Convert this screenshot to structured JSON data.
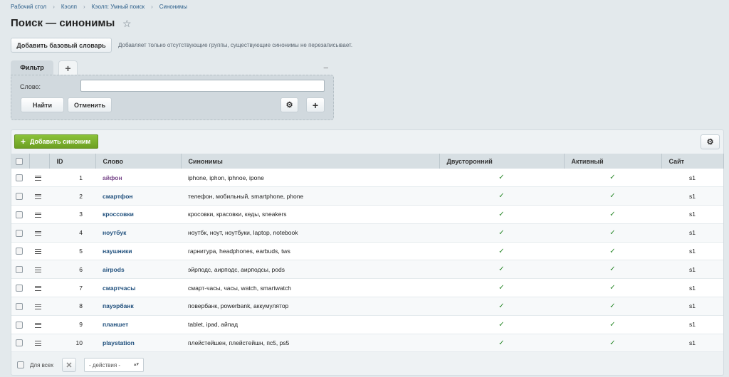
{
  "breadcrumb": [
    "Рабочий стол",
    "Кэолп",
    "Кэолп: Умный поиск",
    "Синонимы"
  ],
  "title": "Поиск — синонимы",
  "toolbar": {
    "base_dict_label": "Добавить базовый словарь",
    "base_dict_hint": "Добавляет только отсутствующие группы, существующие синонимы не перезаписывает."
  },
  "filter": {
    "tab_label": "Фильтр",
    "add_tab": "+",
    "collapse": "−",
    "word_label": "Слово:",
    "word_value": "",
    "find_label": "Найти",
    "cancel_label": "Отменить",
    "gear": "⚙",
    "plus": "+"
  },
  "grid": {
    "add_label": "Добавить синоним",
    "add_icon": "+",
    "gear": "⚙",
    "columns": [
      "ID",
      "Слово",
      "Синонимы",
      "Двусторонний",
      "Активный",
      "Сайт"
    ],
    "rows": [
      {
        "id": "1",
        "word": "айфон",
        "synonyms": "iphone, iphon, iphnoe, ipone",
        "two_way": "✓",
        "active": "✓",
        "site": "s1"
      },
      {
        "id": "2",
        "word": "смартфон",
        "synonyms": "телефон, мобильный, smartphone, phone",
        "two_way": "✓",
        "active": "✓",
        "site": "s1"
      },
      {
        "id": "3",
        "word": "кроссовки",
        "synonyms": "кросовки, красовки, кеды, sneakers",
        "two_way": "✓",
        "active": "✓",
        "site": "s1"
      },
      {
        "id": "4",
        "word": "ноутбук",
        "synonyms": "ноутбк, ноут, ноутбуки, laptop, notebook",
        "two_way": "✓",
        "active": "✓",
        "site": "s1"
      },
      {
        "id": "5",
        "word": "наушники",
        "synonyms": "гарнитура, headphones, earbuds, tws",
        "two_way": "✓",
        "active": "✓",
        "site": "s1"
      },
      {
        "id": "6",
        "word": "airpods",
        "synonyms": "эйрподс, аирподс, аирподсы, pods",
        "two_way": "✓",
        "active": "✓",
        "site": "s1"
      },
      {
        "id": "7",
        "word": "смартчасы",
        "synonyms": "смарт-часы, часы, watch, smartwatch",
        "two_way": "✓",
        "active": "✓",
        "site": "s1"
      },
      {
        "id": "8",
        "word": "пауэрбанк",
        "synonyms": "повербанк, powerbank, аккумулятор",
        "two_way": "✓",
        "active": "✓",
        "site": "s1"
      },
      {
        "id": "9",
        "word": "планшет",
        "synonyms": "tablet, ipad, айпад",
        "two_way": "✓",
        "active": "✓",
        "site": "s1"
      },
      {
        "id": "10",
        "word": "playstation",
        "synonyms": "плейстейшен, плейстейшн, пс5, ps5",
        "two_way": "✓",
        "active": "✓",
        "site": "s1"
      }
    ]
  },
  "footer": {
    "for_all_label": "Для всех",
    "delete_icon": "✕",
    "actions_label": "- действия -",
    "actions_arrow": "▴▾"
  },
  "colors": {
    "accent_green": "#7cb32e",
    "link": "#1f4f7c",
    "check": "#2d8a2d"
  }
}
